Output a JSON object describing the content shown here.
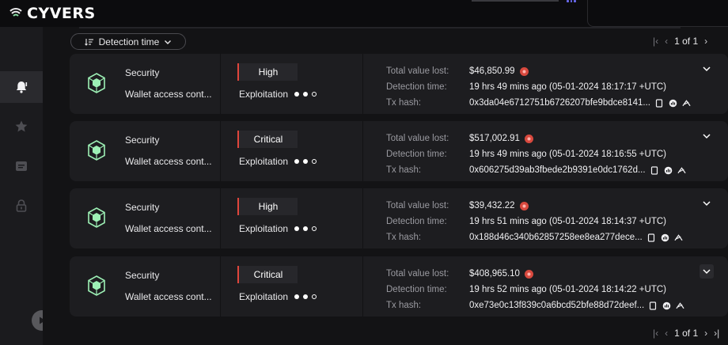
{
  "app": {
    "name": "CYVERS"
  },
  "sort": {
    "label": "Detection time"
  },
  "pagination_top": {
    "text": "1 of 1"
  },
  "pagination_bottom": {
    "text": "1 of 1"
  },
  "detail_labels": {
    "total_value_lost": "Total value lost:",
    "detection_time": "Detection time:",
    "tx_hash": "Tx hash:"
  },
  "alerts": [
    {
      "category": "Security",
      "subcategory": "Wallet access cont...",
      "severity": "High",
      "phase": "Exploitation",
      "total_value_lost": "$46,850.99",
      "detection_time": "19 hrs 49 mins ago (05-01-2024 18:17:17 +UTC)",
      "tx_hash": "0x3da04e6712751b6726207bfe9bdce8141..."
    },
    {
      "category": "Security",
      "subcategory": "Wallet access cont...",
      "severity": "Critical",
      "phase": "Exploitation",
      "total_value_lost": "$517,002.91",
      "detection_time": "19 hrs 49 mins ago (05-01-2024 18:16:55 +UTC)",
      "tx_hash": "0x606275d39ab3fbede2b9391e0dc1762d..."
    },
    {
      "category": "Security",
      "subcategory": "Wallet access cont...",
      "severity": "High",
      "phase": "Exploitation",
      "total_value_lost": "$39,432.22",
      "detection_time": "19 hrs 51 mins ago (05-01-2024 18:14:37 +UTC)",
      "tx_hash": "0x188d46c340b62857258ee8ea277dece..."
    },
    {
      "category": "Security",
      "subcategory": "Wallet access cont...",
      "severity": "Critical",
      "phase": "Exploitation",
      "total_value_lost": "$408,965.10",
      "detection_time": "19 hrs 52 mins ago (05-01-2024 18:14:22 +UTC)",
      "tx_hash": "0xe73e0c13f839c0a6bcd52bfe88d72deef..."
    }
  ],
  "colors": {
    "severity_bar": "#e0453c",
    "cube_icon": "#9df0b5",
    "warning": "#d8493e"
  },
  "icons": {
    "sidebar": [
      "bell-icon",
      "star-icon",
      "message-icon",
      "lock-icon"
    ],
    "row_actions": [
      "copy-icon",
      "explorer-icon",
      "investigate-icon"
    ]
  }
}
